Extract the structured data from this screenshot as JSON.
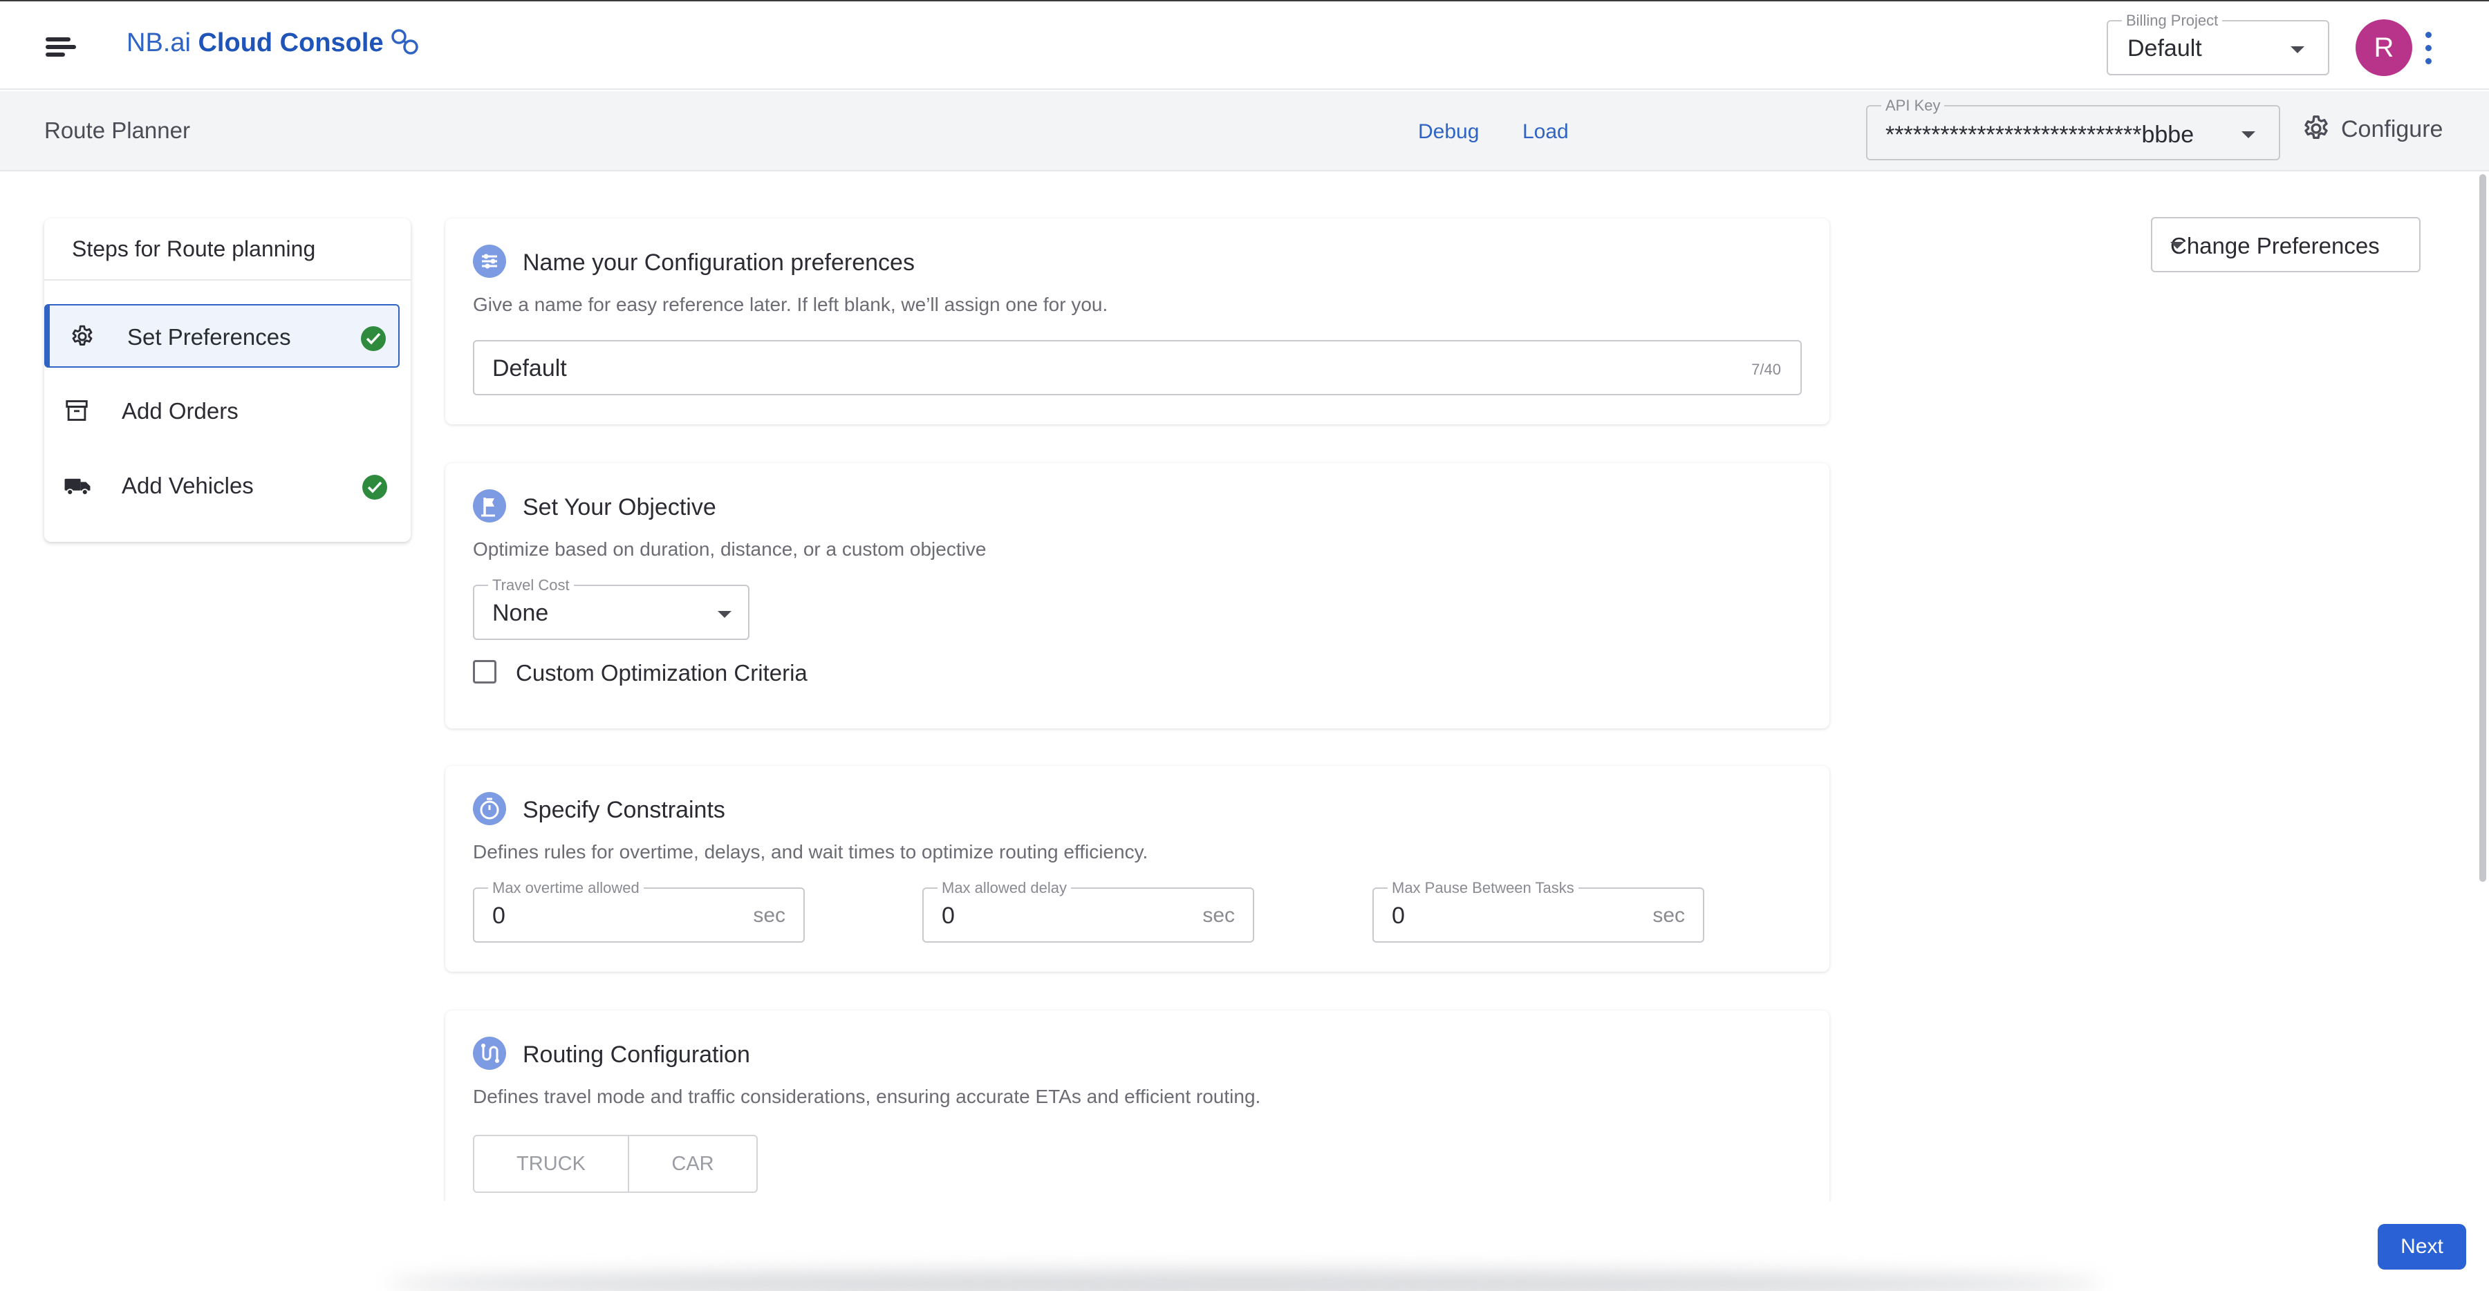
{
  "header": {
    "brand_prefix": "NB.ai",
    "brand_name": "Cloud Console",
    "billing_project_label": "Billing Project",
    "billing_project_value": "Default",
    "avatar_initial": "R"
  },
  "subheader": {
    "page_title": "Route Planner",
    "debug_label": "Debug",
    "load_label": "Load",
    "api_key_label": "API Key",
    "api_key_value": "****************************bbbe",
    "configure_label": "Configure"
  },
  "steps": {
    "title": "Steps for Route planning",
    "items": [
      {
        "label": "Set Preferences",
        "icon": "gear-icon",
        "completed": true,
        "active": true
      },
      {
        "label": "Add Orders",
        "icon": "archive-box-icon",
        "completed": false,
        "active": false
      },
      {
        "label": "Add Vehicles",
        "icon": "truck-icon",
        "completed": true,
        "active": false
      }
    ]
  },
  "change_preferences_label": "Change Preferences",
  "sections": {
    "name": {
      "title": "Name your Configuration preferences",
      "description": "Give a name for easy reference later. If left blank, we’ll assign one for you.",
      "value": "Default",
      "counter": "7/40"
    },
    "objective": {
      "title": "Set Your Objective",
      "description": "Optimize based on duration, distance, or a custom objective",
      "travel_cost_label": "Travel Cost",
      "travel_cost_value": "None",
      "custom_label": "Custom Optimization Criteria"
    },
    "constraints": {
      "title": "Specify Constraints",
      "description": "Defines rules for overtime, delays, and wait times to optimize routing efficiency.",
      "fields": [
        {
          "label": "Max overtime allowed",
          "value": "0",
          "unit": "sec"
        },
        {
          "label": "Max allowed delay",
          "value": "0",
          "unit": "sec"
        },
        {
          "label": "Max Pause Between Tasks",
          "value": "0",
          "unit": "sec"
        }
      ]
    },
    "routing": {
      "title": "Routing Configuration",
      "description": "Defines travel mode and traffic considerations, ensuring accurate ETAs and efficient routing.",
      "modes": [
        "TRUCK",
        "CAR"
      ]
    }
  },
  "footer": {
    "next_label": "Next"
  },
  "colors": {
    "brand": "#2f64c4",
    "success": "#2e8b3e",
    "avatar": "#b8348b",
    "primary_button": "#2a62d6"
  }
}
